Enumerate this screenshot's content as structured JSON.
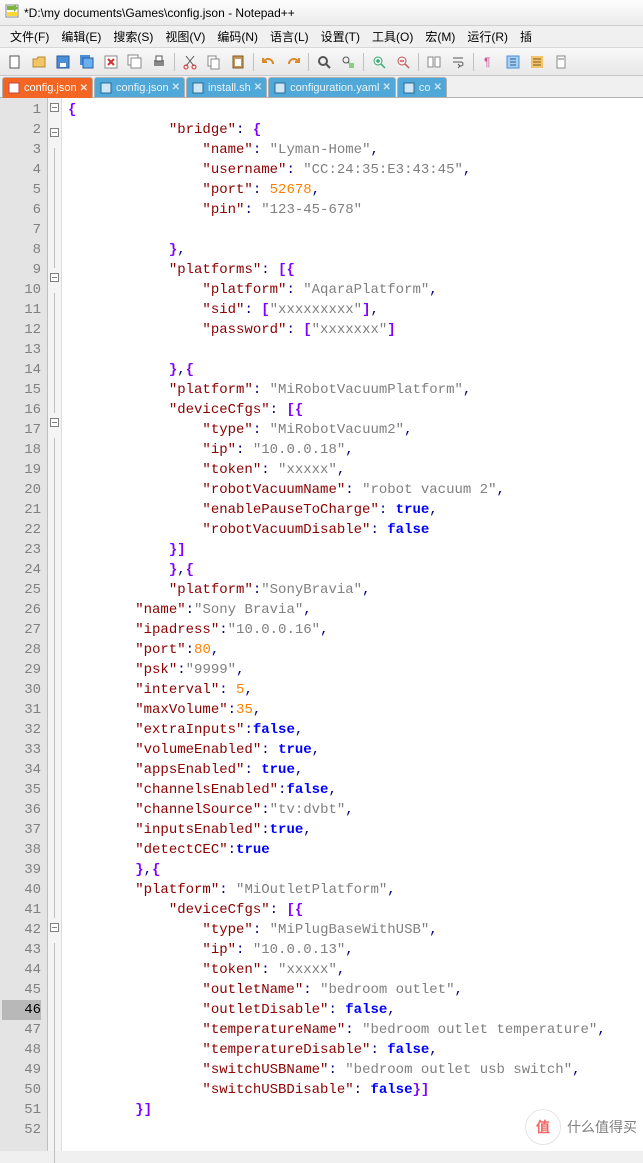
{
  "window": {
    "title": "*D:\\my documents\\Games\\config.json - Notepad++"
  },
  "menu": {
    "file": "文件(F)",
    "edit": "编辑(E)",
    "search": "搜索(S)",
    "view": "视图(V)",
    "encoding": "编码(N)",
    "language": "语言(L)",
    "settings": "设置(T)",
    "tools": "工具(O)",
    "macro": "宏(M)",
    "run": "运行(R)",
    "more": "插"
  },
  "tabs": [
    {
      "label": "config.json",
      "active": true
    },
    {
      "label": "config.json",
      "active": false
    },
    {
      "label": "install.sh",
      "active": false
    },
    {
      "label": "configuration.yaml",
      "active": false
    },
    {
      "label": "co",
      "active": false
    }
  ],
  "activeLine": 46,
  "code": {
    "lines": [
      {
        "n": 1,
        "fold": "open",
        "t": [
          {
            "c": "brk",
            "v": "{"
          }
        ]
      },
      {
        "n": 2,
        "fold": "open",
        "i": 3,
        "t": [
          {
            "c": "key",
            "v": "\"bridge\""
          },
          {
            "c": "pun",
            "v": ": "
          },
          {
            "c": "brk",
            "v": "{"
          }
        ]
      },
      {
        "n": 3,
        "i": 4,
        "t": [
          {
            "c": "key",
            "v": "\"name\""
          },
          {
            "c": "pun",
            "v": ": "
          },
          {
            "c": "str",
            "v": "\"Lyman-Home\""
          },
          {
            "c": "pun",
            "v": ","
          }
        ]
      },
      {
        "n": 4,
        "i": 4,
        "t": [
          {
            "c": "key",
            "v": "\"username\""
          },
          {
            "c": "pun",
            "v": ": "
          },
          {
            "c": "str",
            "v": "\"CC:24:35:E3:43:45\""
          },
          {
            "c": "pun",
            "v": ","
          }
        ]
      },
      {
        "n": 5,
        "i": 4,
        "t": [
          {
            "c": "key",
            "v": "\"port\""
          },
          {
            "c": "pun",
            "v": ": "
          },
          {
            "c": "num",
            "v": "52678"
          },
          {
            "c": "pun",
            "v": ","
          }
        ]
      },
      {
        "n": 6,
        "i": 4,
        "t": [
          {
            "c": "key",
            "v": "\"pin\""
          },
          {
            "c": "pun",
            "v": ": "
          },
          {
            "c": "str",
            "v": "\"123-45-678\""
          }
        ]
      },
      {
        "n": 7,
        "t": []
      },
      {
        "n": 8,
        "i": 3,
        "t": [
          {
            "c": "brk",
            "v": "}"
          },
          {
            "c": "pun",
            "v": ","
          }
        ]
      },
      {
        "n": 9,
        "fold": "open",
        "i": 3,
        "t": [
          {
            "c": "key",
            "v": "\"platforms\""
          },
          {
            "c": "pun",
            "v": ": "
          },
          {
            "c": "brk",
            "v": "[{"
          }
        ]
      },
      {
        "n": 10,
        "i": 4,
        "t": [
          {
            "c": "key",
            "v": "\"platform\""
          },
          {
            "c": "pun",
            "v": ": "
          },
          {
            "c": "str",
            "v": "\"AqaraPlatform\""
          },
          {
            "c": "pun",
            "v": ","
          }
        ]
      },
      {
        "n": 11,
        "i": 4,
        "t": [
          {
            "c": "key",
            "v": "\"sid\""
          },
          {
            "c": "pun",
            "v": ": "
          },
          {
            "c": "brk",
            "v": "["
          },
          {
            "c": "str",
            "v": "\"xxxxxxxxx\""
          },
          {
            "c": "brk",
            "v": "]"
          },
          {
            "c": "pun",
            "v": ","
          }
        ]
      },
      {
        "n": 12,
        "i": 4,
        "t": [
          {
            "c": "key",
            "v": "\"password\""
          },
          {
            "c": "pun",
            "v": ": "
          },
          {
            "c": "brk",
            "v": "["
          },
          {
            "c": "str",
            "v": "\"xxxxxxx\""
          },
          {
            "c": "brk",
            "v": "]"
          }
        ]
      },
      {
        "n": 13,
        "t": []
      },
      {
        "n": 14,
        "i": 3,
        "t": [
          {
            "c": "brk",
            "v": "}"
          },
          {
            "c": "pun",
            "v": ","
          },
          {
            "c": "brk",
            "v": "{"
          }
        ]
      },
      {
        "n": 15,
        "i": 3,
        "t": [
          {
            "c": "key",
            "v": "\"platform\""
          },
          {
            "c": "pun",
            "v": ": "
          },
          {
            "c": "str",
            "v": "\"MiRobotVacuumPlatform\""
          },
          {
            "c": "pun",
            "v": ","
          }
        ]
      },
      {
        "n": 16,
        "fold": "open",
        "i": 3,
        "t": [
          {
            "c": "key",
            "v": "\"deviceCfgs\""
          },
          {
            "c": "pun",
            "v": ": "
          },
          {
            "c": "brk",
            "v": "[{"
          }
        ]
      },
      {
        "n": 17,
        "i": 4,
        "t": [
          {
            "c": "key",
            "v": "\"type\""
          },
          {
            "c": "pun",
            "v": ": "
          },
          {
            "c": "str",
            "v": "\"MiRobotVacuum2\""
          },
          {
            "c": "pun",
            "v": ","
          }
        ]
      },
      {
        "n": 18,
        "i": 4,
        "t": [
          {
            "c": "key",
            "v": "\"ip\""
          },
          {
            "c": "pun",
            "v": ": "
          },
          {
            "c": "str",
            "v": "\"10.0.0.18\""
          },
          {
            "c": "pun",
            "v": ","
          }
        ]
      },
      {
        "n": 19,
        "i": 4,
        "t": [
          {
            "c": "key",
            "v": "\"token\""
          },
          {
            "c": "pun",
            "v": ": "
          },
          {
            "c": "str",
            "v": "\"xxxxx\""
          },
          {
            "c": "pun",
            "v": ","
          }
        ]
      },
      {
        "n": 20,
        "i": 4,
        "t": [
          {
            "c": "key",
            "v": "\"robotVacuumName\""
          },
          {
            "c": "pun",
            "v": ": "
          },
          {
            "c": "str",
            "v": "\"robot vacuum 2\""
          },
          {
            "c": "pun",
            "v": ","
          }
        ]
      },
      {
        "n": 21,
        "i": 4,
        "t": [
          {
            "c": "key",
            "v": "\"enablePauseToCharge\""
          },
          {
            "c": "pun",
            "v": ": "
          },
          {
            "c": "bool",
            "v": "true"
          },
          {
            "c": "pun",
            "v": ","
          }
        ]
      },
      {
        "n": 22,
        "i": 4,
        "t": [
          {
            "c": "key",
            "v": "\"robotVacuumDisable\""
          },
          {
            "c": "pun",
            "v": ": "
          },
          {
            "c": "bool",
            "v": "false"
          }
        ]
      },
      {
        "n": 23,
        "i": 3,
        "t": [
          {
            "c": "brk",
            "v": "}]"
          }
        ]
      },
      {
        "n": 24,
        "i": 3,
        "t": [
          {
            "c": "brk",
            "v": "}"
          },
          {
            "c": "pun",
            "v": ","
          },
          {
            "c": "brk",
            "v": "{"
          }
        ]
      },
      {
        "n": 25,
        "i": 3,
        "t": [
          {
            "c": "key",
            "v": "\"platform\""
          },
          {
            "c": "pun",
            "v": ":"
          },
          {
            "c": "str",
            "v": "\"SonyBravia\""
          },
          {
            "c": "pun",
            "v": ","
          }
        ]
      },
      {
        "n": 26,
        "i": 2,
        "t": [
          {
            "c": "key",
            "v": "\"name\""
          },
          {
            "c": "pun",
            "v": ":"
          },
          {
            "c": "str",
            "v": "\"Sony Bravia\""
          },
          {
            "c": "pun",
            "v": ","
          }
        ]
      },
      {
        "n": 27,
        "i": 2,
        "t": [
          {
            "c": "key",
            "v": "\"ipadress\""
          },
          {
            "c": "pun",
            "v": ":"
          },
          {
            "c": "str",
            "v": "\"10.0.0.16\""
          },
          {
            "c": "pun",
            "v": ","
          }
        ]
      },
      {
        "n": 28,
        "i": 2,
        "t": [
          {
            "c": "key",
            "v": "\"port\""
          },
          {
            "c": "pun",
            "v": ":"
          },
          {
            "c": "num",
            "v": "80"
          },
          {
            "c": "pun",
            "v": ","
          }
        ]
      },
      {
        "n": 29,
        "i": 2,
        "t": [
          {
            "c": "key",
            "v": "\"psk\""
          },
          {
            "c": "pun",
            "v": ":"
          },
          {
            "c": "str",
            "v": "\"9999\""
          },
          {
            "c": "pun",
            "v": ","
          }
        ]
      },
      {
        "n": 30,
        "i": 2,
        "t": [
          {
            "c": "key",
            "v": "\"interval\""
          },
          {
            "c": "pun",
            "v": ": "
          },
          {
            "c": "num",
            "v": "5"
          },
          {
            "c": "pun",
            "v": ","
          }
        ]
      },
      {
        "n": 31,
        "i": 2,
        "t": [
          {
            "c": "key",
            "v": "\"maxVolume\""
          },
          {
            "c": "pun",
            "v": ":"
          },
          {
            "c": "num",
            "v": "35"
          },
          {
            "c": "pun",
            "v": ","
          }
        ]
      },
      {
        "n": 32,
        "i": 2,
        "t": [
          {
            "c": "key",
            "v": "\"extraInputs\""
          },
          {
            "c": "pun",
            "v": ":"
          },
          {
            "c": "bool",
            "v": "false"
          },
          {
            "c": "pun",
            "v": ","
          }
        ]
      },
      {
        "n": 33,
        "i": 2,
        "t": [
          {
            "c": "key",
            "v": "\"volumeEnabled\""
          },
          {
            "c": "pun",
            "v": ": "
          },
          {
            "c": "bool",
            "v": "true"
          },
          {
            "c": "pun",
            "v": ","
          }
        ]
      },
      {
        "n": 34,
        "i": 2,
        "t": [
          {
            "c": "key",
            "v": "\"appsEnabled\""
          },
          {
            "c": "pun",
            "v": ": "
          },
          {
            "c": "bool",
            "v": "true"
          },
          {
            "c": "pun",
            "v": ","
          }
        ]
      },
      {
        "n": 35,
        "i": 2,
        "t": [
          {
            "c": "key",
            "v": "\"channelsEnabled\""
          },
          {
            "c": "pun",
            "v": ":"
          },
          {
            "c": "bool",
            "v": "false"
          },
          {
            "c": "pun",
            "v": ","
          }
        ]
      },
      {
        "n": 36,
        "i": 2,
        "t": [
          {
            "c": "key",
            "v": "\"channelSource\""
          },
          {
            "c": "pun",
            "v": ":"
          },
          {
            "c": "str",
            "v": "\"tv:dvbt\""
          },
          {
            "c": "pun",
            "v": ","
          }
        ]
      },
      {
        "n": 37,
        "i": 2,
        "t": [
          {
            "c": "key",
            "v": "\"inputsEnabled\""
          },
          {
            "c": "pun",
            "v": ":"
          },
          {
            "c": "bool",
            "v": "true"
          },
          {
            "c": "pun",
            "v": ","
          }
        ]
      },
      {
        "n": 38,
        "i": 2,
        "t": [
          {
            "c": "key",
            "v": "\"detectCEC\""
          },
          {
            "c": "pun",
            "v": ":"
          },
          {
            "c": "bool",
            "v": "true"
          }
        ]
      },
      {
        "n": 39,
        "i": 2,
        "t": [
          {
            "c": "brk",
            "v": "}"
          },
          {
            "c": "pun",
            "v": ","
          },
          {
            "c": "brk",
            "v": "{"
          }
        ]
      },
      {
        "n": 40,
        "i": 2,
        "t": [
          {
            "c": "key",
            "v": "\"platform\""
          },
          {
            "c": "pun",
            "v": ": "
          },
          {
            "c": "str",
            "v": "\"MiOutletPlatform\""
          },
          {
            "c": "pun",
            "v": ","
          }
        ]
      },
      {
        "n": 41,
        "fold": "open",
        "i": 3,
        "t": [
          {
            "c": "key",
            "v": "\"deviceCfgs\""
          },
          {
            "c": "pun",
            "v": ": "
          },
          {
            "c": "brk",
            "v": "[{"
          }
        ]
      },
      {
        "n": 42,
        "i": 4,
        "t": [
          {
            "c": "key",
            "v": "\"type\""
          },
          {
            "c": "pun",
            "v": ": "
          },
          {
            "c": "str",
            "v": "\"MiPlugBaseWithUSB\""
          },
          {
            "c": "pun",
            "v": ","
          }
        ]
      },
      {
        "n": 43,
        "i": 4,
        "t": [
          {
            "c": "key",
            "v": "\"ip\""
          },
          {
            "c": "pun",
            "v": ": "
          },
          {
            "c": "str",
            "v": "\"10.0.0.13\""
          },
          {
            "c": "pun",
            "v": ","
          }
        ]
      },
      {
        "n": 44,
        "i": 4,
        "t": [
          {
            "c": "key",
            "v": "\"token\""
          },
          {
            "c": "pun",
            "v": ": "
          },
          {
            "c": "str",
            "v": "\"xxxxx\""
          },
          {
            "c": "pun",
            "v": ","
          }
        ]
      },
      {
        "n": 45,
        "i": 4,
        "t": [
          {
            "c": "key",
            "v": "\"outletName\""
          },
          {
            "c": "pun",
            "v": ": "
          },
          {
            "c": "str",
            "v": "\"bedroom outlet\""
          },
          {
            "c": "pun",
            "v": ","
          }
        ]
      },
      {
        "n": 46,
        "i": 4,
        "t": [
          {
            "c": "key",
            "v": "\"outletDisable\""
          },
          {
            "c": "pun",
            "v": ": "
          },
          {
            "c": "bool",
            "v": "false"
          },
          {
            "c": "pun",
            "v": ","
          }
        ]
      },
      {
        "n": 47,
        "i": 4,
        "t": [
          {
            "c": "key",
            "v": "\"temperatureName\""
          },
          {
            "c": "pun",
            "v": ": "
          },
          {
            "c": "str",
            "v": "\"bedroom outlet temperature\""
          },
          {
            "c": "pun",
            "v": ","
          }
        ]
      },
      {
        "n": 48,
        "i": 4,
        "t": [
          {
            "c": "key",
            "v": "\"temperatureDisable\""
          },
          {
            "c": "pun",
            "v": ": "
          },
          {
            "c": "bool",
            "v": "false"
          },
          {
            "c": "pun",
            "v": ","
          }
        ]
      },
      {
        "n": 49,
        "i": 4,
        "t": [
          {
            "c": "key",
            "v": "\"switchUSBName\""
          },
          {
            "c": "pun",
            "v": ": "
          },
          {
            "c": "str",
            "v": "\"bedroom outlet usb switch\""
          },
          {
            "c": "pun",
            "v": ","
          }
        ]
      },
      {
        "n": 50,
        "i": 4,
        "t": [
          {
            "c": "key",
            "v": "\"switchUSBDisable\""
          },
          {
            "c": "pun",
            "v": ": "
          },
          {
            "c": "bool",
            "v": "false"
          },
          {
            "c": "brk",
            "v": "}]"
          }
        ]
      },
      {
        "n": 51,
        "i": 2,
        "t": [
          {
            "c": "brk",
            "v": "}]"
          }
        ]
      },
      {
        "n": 52,
        "t": []
      }
    ]
  },
  "watermark": {
    "badge": "值",
    "text": "什么值得买"
  }
}
